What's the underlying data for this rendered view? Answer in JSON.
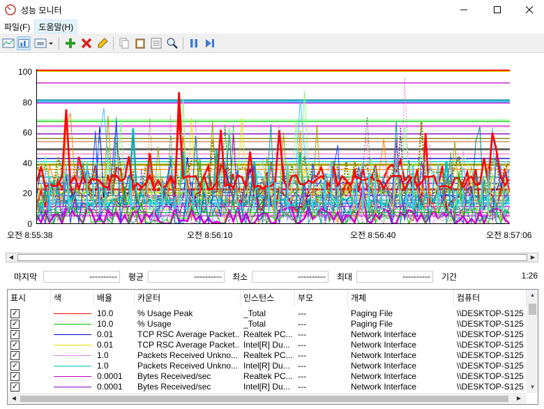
{
  "window": {
    "title": "성능 모니터"
  },
  "menu": {
    "items": [
      "파일(F)",
      "도움말(H)"
    ]
  },
  "toolbar": {
    "icons": [
      "view-graph-icon",
      "view-histogram-icon",
      "change-graph-type-icon",
      "add-counter-icon",
      "delete-counter-icon",
      "highlight-icon",
      "copy-properties-icon",
      "paste-counter-list-icon",
      "properties-icon",
      "zoom-icon",
      "freeze-display-icon",
      "update-data-icon"
    ]
  },
  "chart_data": {
    "type": "line",
    "ylim": [
      0,
      100
    ],
    "y_ticks": [
      "100",
      "80",
      "60",
      "40",
      "20",
      "0"
    ],
    "x_ticks": [
      "오전 8:55:38",
      "오전 8:56:10",
      "오전 8:56:40",
      "오전 8:57:06"
    ],
    "grid": true
  },
  "stats": {
    "last_label": "마지막",
    "last_value": "----------",
    "avg_label": "평균",
    "avg_value": "----------",
    "min_label": "최소",
    "min_value": "----------",
    "max_label": "최대",
    "max_value": "----------",
    "duration_label": "기간",
    "duration_value": "1:26"
  },
  "table": {
    "headers": {
      "show": "표시",
      "color": "색",
      "scale": "배율",
      "counter": "카운터",
      "instance": "인스턴스",
      "parent": "부모",
      "object": "개체",
      "computer": "컴퓨터"
    },
    "rows": [
      {
        "color": "#ff0000",
        "scale": "10.0",
        "counter": "% Usage Peak",
        "instance": "_Total",
        "parent": "---",
        "object": "Paging File",
        "computer": "\\\\DESKTOP-S125"
      },
      {
        "color": "#00c000",
        "scale": "10.0",
        "counter": "% Usage",
        "instance": "_Total",
        "parent": "---",
        "object": "Paging File",
        "computer": "\\\\DESKTOP-S125"
      },
      {
        "color": "#0000c0",
        "scale": "0.01",
        "counter": "TCP RSC Average Packet...",
        "instance": "Realtek PC...",
        "parent": "---",
        "object": "Network Interface",
        "computer": "\\\\DESKTOP-S125"
      },
      {
        "color": "#e0e000",
        "scale": "0.01",
        "counter": "TCP RSC Average Packet...",
        "instance": "Intel[R] Du...",
        "parent": "---",
        "object": "Network Interface",
        "computer": "\\\\DESKTOP-S125"
      },
      {
        "color": "#e080e0",
        "scale": "1.0",
        "counter": "Packets Received Unkno...",
        "instance": "Realtek PC...",
        "parent": "---",
        "object": "Network Interface",
        "computer": "\\\\DESKTOP-S125"
      },
      {
        "color": "#00c0c0",
        "scale": "1.0",
        "counter": "Packets Received Unkno...",
        "instance": "Intel[R] Du...",
        "parent": "---",
        "object": "Network Interface",
        "computer": "\\\\DESKTOP-S125"
      },
      {
        "color": "#c000c0",
        "scale": "0.0001",
        "counter": "Bytes Received/sec",
        "instance": "Realtek PC...",
        "parent": "---",
        "object": "Network Interface",
        "computer": "\\\\DESKTOP-S125"
      },
      {
        "color": "#8000c0",
        "scale": "0.0001",
        "counter": "Bytes Received/sec",
        "instance": "Intel[R] Du...",
        "parent": "---",
        "object": "Network Interface",
        "computer": "\\\\DESKTOP-S125"
      }
    ]
  }
}
